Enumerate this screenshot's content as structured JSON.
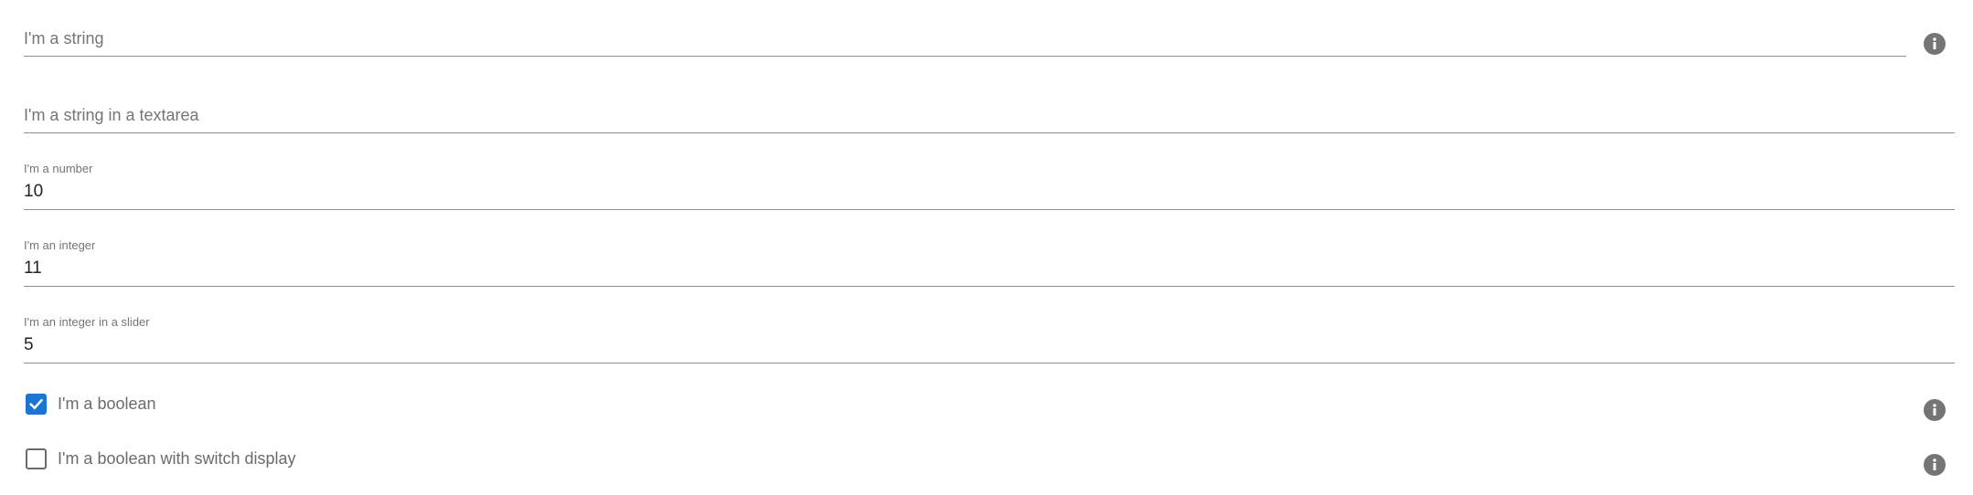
{
  "form": {
    "string_field": {
      "label": "I'm a string",
      "value": ""
    },
    "textarea_field": {
      "label": "I'm a string in a textarea",
      "value": ""
    },
    "number_field": {
      "label": "I'm a number",
      "value": "10"
    },
    "integer_field": {
      "label": "I'm an integer",
      "value": "11"
    },
    "slider_field": {
      "label": "I'm an integer in a slider",
      "value": "5"
    },
    "boolean_field": {
      "label": "I'm a boolean",
      "checked": true
    },
    "switch_field": {
      "label": "I'm a boolean with switch display",
      "checked": false
    }
  },
  "icons": {
    "info": "info-icon",
    "check": "check-icon"
  },
  "colors": {
    "accent": "#1976d2",
    "icon_gray": "#757575",
    "underline": "#8f8f8f",
    "label_gray": "#757575"
  }
}
